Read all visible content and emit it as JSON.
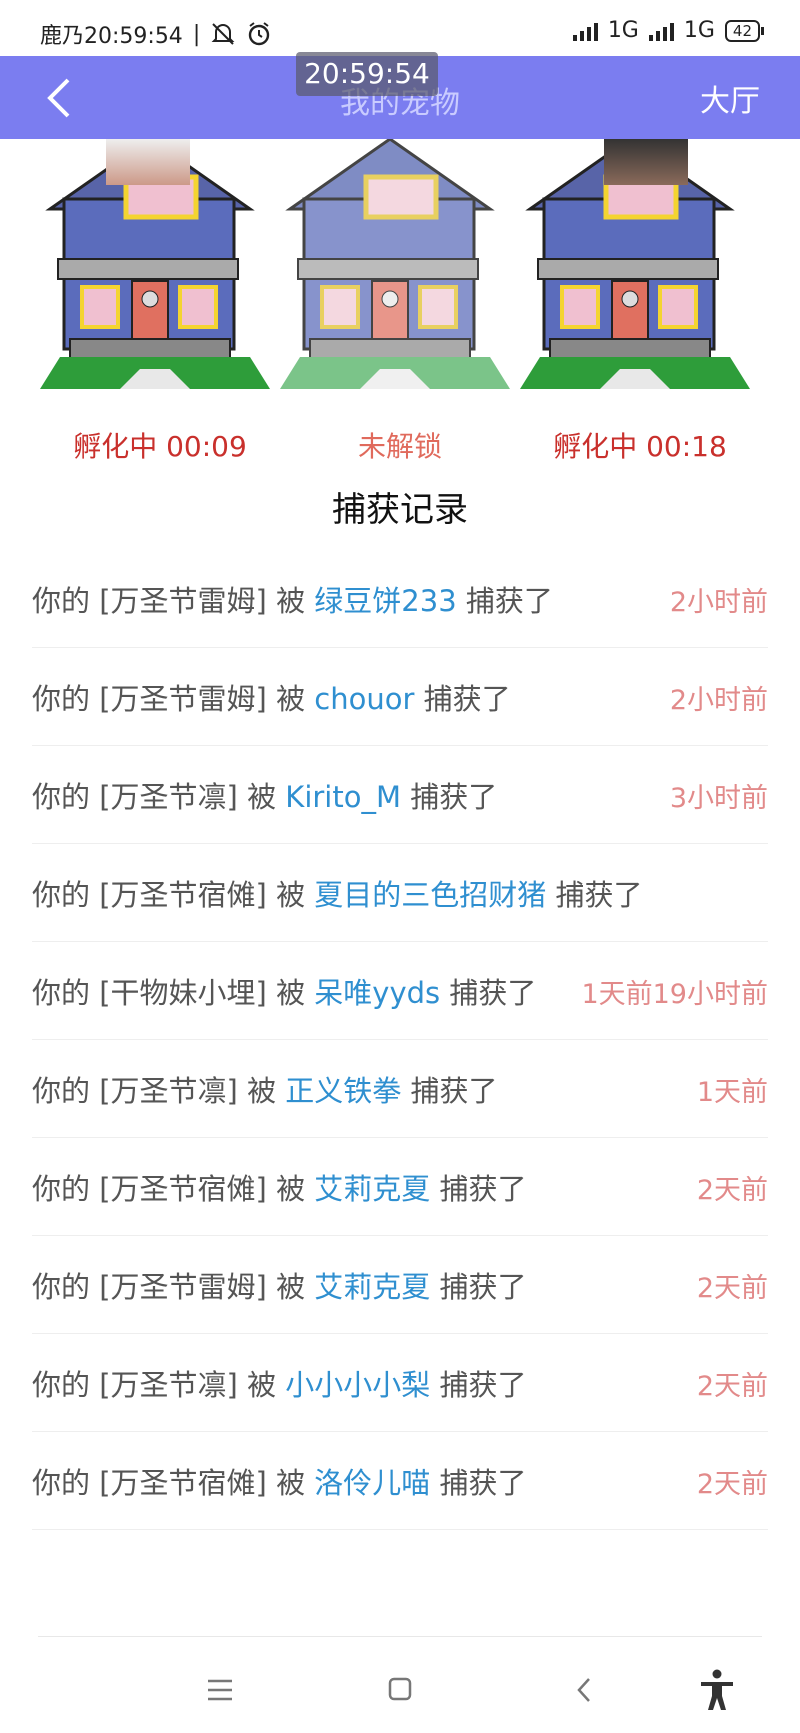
{
  "status_bar": {
    "time_text": "鹿乃20:59:54",
    "separator": "|",
    "network1": "1G",
    "network2": "1G",
    "battery": "42"
  },
  "header": {
    "title": "我的宠物",
    "lobby_label": "大厅",
    "clock_overlay": "20:59:54"
  },
  "houses": [
    {
      "status": "孵化中 00:09",
      "state": "hatching"
    },
    {
      "status": "未解锁",
      "state": "locked"
    },
    {
      "status": "孵化中 00:18",
      "state": "hatching"
    }
  ],
  "section_title": "捕获记录",
  "records": [
    {
      "prefix": "你的 [万圣节雷姆] 被 ",
      "catcher": "绿豆饼233",
      "suffix": " 捕获了",
      "time": "2小时前"
    },
    {
      "prefix": "你的 [万圣节雷姆] 被 ",
      "catcher": "chouor",
      "suffix": " 捕获了",
      "time": "2小时前"
    },
    {
      "prefix": "你的 [万圣节凛] 被 ",
      "catcher": "Kirito_M",
      "suffix": " 捕获了",
      "time": "3小时前"
    },
    {
      "prefix": "你的 [万圣节宿傩] 被 ",
      "catcher": "夏目的三色招财猪",
      "suffix": " 捕获了",
      "time": ""
    },
    {
      "prefix": "你的 [干物妹小埋] 被 ",
      "catcher": "呆唯yyds",
      "suffix": " 捕获了",
      "time": "1天前19小时前"
    },
    {
      "prefix": "你的 [万圣节凛] 被 ",
      "catcher": "正义铁拳",
      "suffix": " 捕获了",
      "time": "1天前"
    },
    {
      "prefix": "你的 [万圣节宿傩] 被 ",
      "catcher": "艾莉克夏",
      "suffix": " 捕获了",
      "time": "2天前"
    },
    {
      "prefix": "你的 [万圣节雷姆] 被 ",
      "catcher": "艾莉克夏",
      "suffix": " 捕获了",
      "time": "2天前"
    },
    {
      "prefix": "你的 [万圣节凛] 被 ",
      "catcher": "小小小小梨",
      "suffix": " 捕获了",
      "time": "2天前"
    },
    {
      "prefix": "你的 [万圣节宿傩] 被 ",
      "catcher": "洛伶儿喵",
      "suffix": " 捕获了",
      "time": "2天前"
    }
  ],
  "nav": {
    "menu_icon": "menu-icon",
    "home_icon": "home-square-icon",
    "back_icon": "back-chevron-icon",
    "accessibility_icon": "accessibility-icon"
  },
  "colors": {
    "header_bg": "#7b7df0",
    "catcher_text": "#2f8fd0",
    "time_text": "#e28a8a",
    "hatching_text": "#c9302c"
  }
}
